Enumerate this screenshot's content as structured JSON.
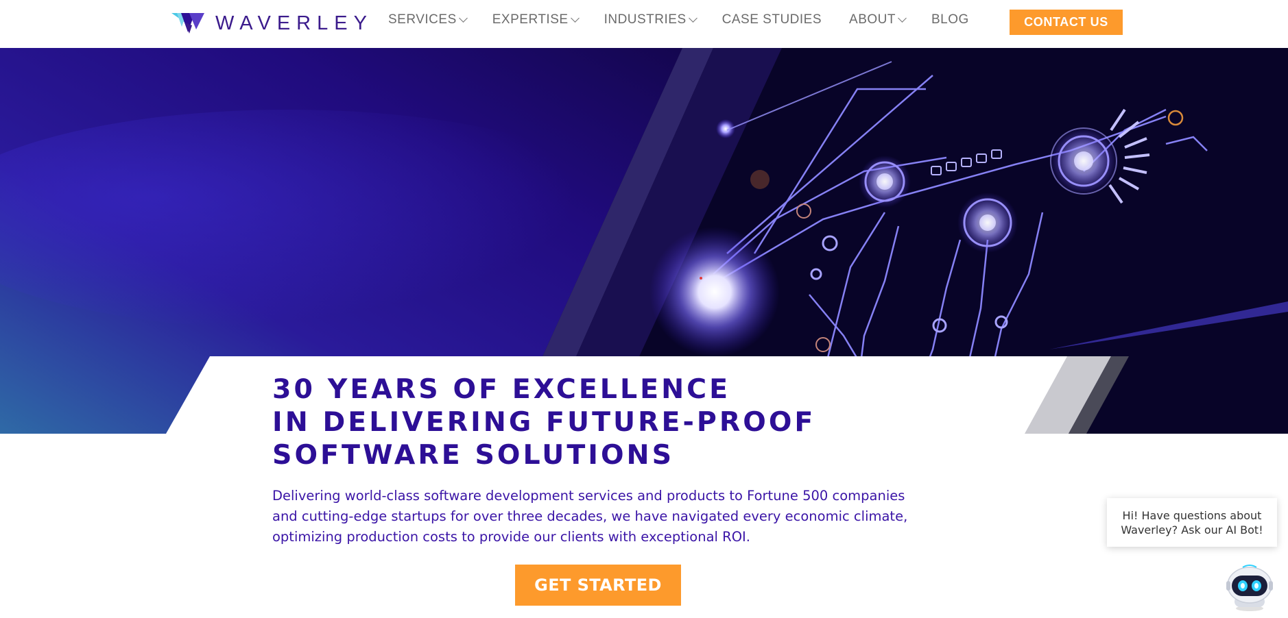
{
  "brand": {
    "name": "WAVERLEY",
    "colors": {
      "primary": "#2d0f96",
      "accent": "#fd9a2c",
      "logo_cyan": "#49c8e6"
    }
  },
  "nav": {
    "items": [
      {
        "label": "SERVICES",
        "has_dropdown": true
      },
      {
        "label": "EXPERTISE",
        "has_dropdown": true
      },
      {
        "label": "INDUSTRIES",
        "has_dropdown": true
      },
      {
        "label": "CASE STUDIES",
        "has_dropdown": false
      },
      {
        "label": "ABOUT",
        "has_dropdown": true
      },
      {
        "label": "BLOG",
        "has_dropdown": false
      }
    ],
    "contact_label": "CONTACT US"
  },
  "hero": {
    "headline": [
      "30 YEARS OF EXCELLENCE",
      "IN DELIVERING FUTURE-PROOF",
      "SOFTWARE SOLUTIONS"
    ],
    "description": "Delivering world-class software development services and products to Fortune 500 companies and cutting-edge startups for over three decades, we have navigated every economic climate, optimizing production costs to provide our clients with exceptional ROI.",
    "cta_label": "GET STARTED"
  },
  "chat": {
    "message": "Hi! Have questions about Waverley? Ask our AI Bot!",
    "icon": "robot-icon"
  }
}
